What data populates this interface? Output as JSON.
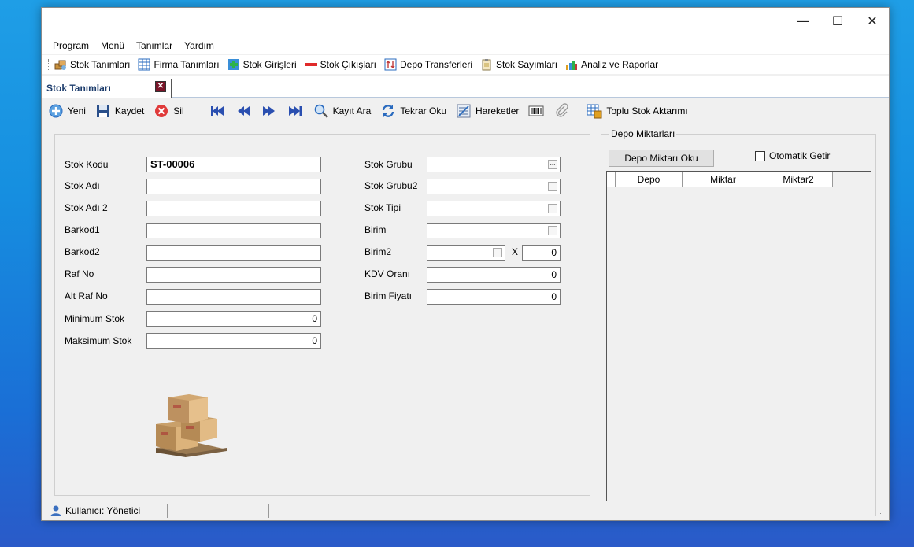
{
  "window": {
    "controls": {
      "minimize": "—",
      "maximize": "☐",
      "close": "✕"
    }
  },
  "menu": [
    "Program",
    "Menü",
    "Tanımlar",
    "Yardım"
  ],
  "quickbar": [
    {
      "label": "Stok Tanımları",
      "icon": "boxes-icon"
    },
    {
      "label": "Firma Tanımları",
      "icon": "grid-table-icon"
    },
    {
      "label": "Stok Girişleri",
      "icon": "plus-green-icon"
    },
    {
      "label": "Stok Çıkışları",
      "icon": "minus-red-icon"
    },
    {
      "label": "Depo Transferleri",
      "icon": "transfer-icon"
    },
    {
      "label": "Stok Sayımları",
      "icon": "clipboard-icon"
    },
    {
      "label": "Analiz ve Raporlar",
      "icon": "chart-icon"
    }
  ],
  "tab": {
    "label": "Stok Tanımları",
    "close": "✕"
  },
  "toolbar": {
    "new": "Yeni",
    "save": "Kaydet",
    "delete": "Sil",
    "search": "Kayıt Ara",
    "reload": "Tekrar Oku",
    "movements": "Hareketler",
    "bulk": "Toplu Stok Aktarımı"
  },
  "form": {
    "left": [
      {
        "label": "Stok Kodu",
        "value": "ST-00006"
      },
      {
        "label": "Stok Adı",
        "value": ""
      },
      {
        "label": "Stok Adı 2",
        "value": ""
      },
      {
        "label": "Barkod1",
        "value": ""
      },
      {
        "label": "Barkod2",
        "value": ""
      },
      {
        "label": "Raf No",
        "value": ""
      },
      {
        "label": "Alt Raf No",
        "value": ""
      },
      {
        "label": "Minimum Stok",
        "value": "0"
      },
      {
        "label": "Maksimum Stok",
        "value": "0"
      }
    ],
    "right": [
      {
        "label": "Stok Grubu",
        "value": ""
      },
      {
        "label": "Stok Grubu2",
        "value": ""
      },
      {
        "label": "Stok Tipi",
        "value": ""
      },
      {
        "label": "Birim",
        "value": ""
      },
      {
        "label": "Birim2",
        "value": "",
        "multiplier_label": "X",
        "multiplier": "0"
      },
      {
        "label": "KDV Oranı",
        "value": "0"
      },
      {
        "label": "Birim Fiyatı",
        "value": "0"
      }
    ],
    "lookup_glyph": "..."
  },
  "depot": {
    "title": "Depo Miktarları",
    "read_button": "Depo Miktarı Oku",
    "auto_label": "Otomatik Getir",
    "columns": [
      "Depo",
      "Miktar",
      "Miktar2"
    ]
  },
  "status": {
    "user": "Kullanıcı: Yönetici"
  },
  "colors": {
    "accent": "#1c3c6c",
    "desktop": "#1a8ce0"
  }
}
